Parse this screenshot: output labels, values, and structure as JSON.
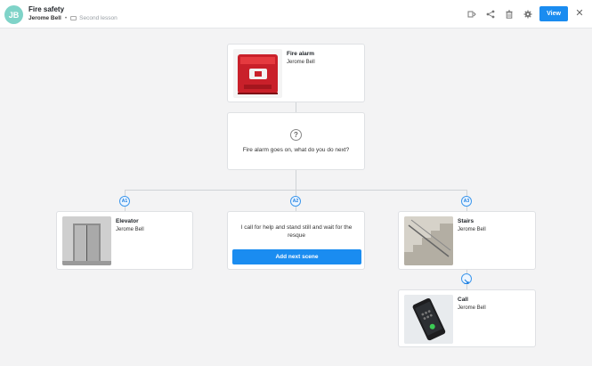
{
  "header": {
    "avatar_initials": "JB",
    "title": "Fire safety",
    "author": "Jerome Bell",
    "separator": "•",
    "lesson": "Second lesson",
    "view_label": "View",
    "close_glyph": "✕",
    "icons": [
      "preview-icon",
      "share-icon",
      "trash-icon",
      "gear-icon",
      "close-icon"
    ]
  },
  "scenes": {
    "root": {
      "title": "Fire alarm",
      "author": "Jerome Bell",
      "image": "fire-alarm-image"
    },
    "question": {
      "icon": "?",
      "text": "Fire alarm goes on, what do you do next?"
    },
    "answers": [
      {
        "badge": "A1",
        "title": "Elevator",
        "author": "Jerome Bell",
        "image": "elevator-image"
      },
      {
        "badge": "A2",
        "text": "I call for help and stand still and wait for the resque",
        "button_label": "Add next scene"
      },
      {
        "badge": "A3",
        "title": "Stairs",
        "author": "Jerome Bell",
        "image": "stairs-image"
      }
    ],
    "followup": {
      "title": "Call",
      "author": "Jerome Bell",
      "image": "phone-image"
    }
  },
  "colors": {
    "accent": "#1a8cf0",
    "avatar": "#7fd3c8",
    "canvas": "#f3f3f4"
  }
}
